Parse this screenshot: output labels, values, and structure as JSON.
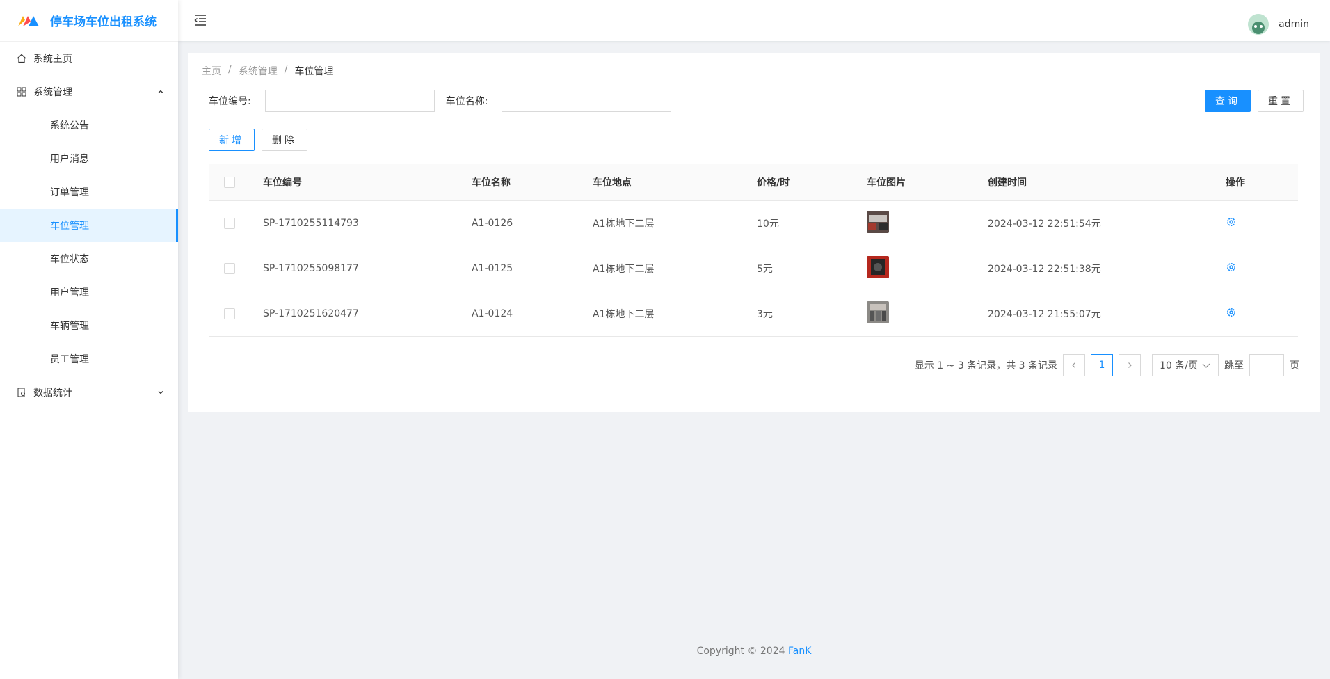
{
  "app": {
    "title": "停车场车位出租系统",
    "brand_colors": [
      "#ff4d4f",
      "#1890ff",
      "#faad14"
    ]
  },
  "sidebar": {
    "items": [
      {
        "label": "系统主页",
        "icon": "home-icon"
      },
      {
        "label": "系统管理",
        "icon": "grid-icon",
        "expanded": true,
        "children": [
          "系统公告",
          "用户消息",
          "订单管理",
          "车位管理",
          "车位状态",
          "用户管理",
          "车辆管理",
          "员工管理"
        ],
        "active_child": "车位管理"
      },
      {
        "label": "数据统计",
        "icon": "chart-file-icon",
        "expanded": false
      }
    ]
  },
  "header": {
    "username": "admin"
  },
  "breadcrumb": [
    "主页",
    "系统管理",
    "车位管理"
  ],
  "search": {
    "code_label": "车位编号:",
    "code_value": "",
    "name_label": "车位名称:",
    "name_value": "",
    "query_button": "查询",
    "reset_button": "重置"
  },
  "actions": {
    "add_button": "新增",
    "delete_button": "删除"
  },
  "table": {
    "columns": [
      "车位编号",
      "车位名称",
      "车位地点",
      "价格/时",
      "车位图片",
      "创建时间",
      "操作"
    ],
    "rows": [
      {
        "code": "SP-1710255114793",
        "name": "A1-0126",
        "location": "A1栋地下二层",
        "price": "10元",
        "time": "2024-03-12 22:51:54元"
      },
      {
        "code": "SP-1710255098177",
        "name": "A1-0125",
        "location": "A1栋地下二层",
        "price": "5元",
        "time": "2024-03-12 22:51:38元"
      },
      {
        "code": "SP-1710251620477",
        "name": "A1-0124",
        "location": "A1栋地下二层",
        "price": "3元",
        "time": "2024-03-12 21:55:07元"
      }
    ]
  },
  "pagination": {
    "info": "显示 1 ~ 3 条记录，共 3 条记录",
    "current_page": "1",
    "page_size": "10 条/页",
    "jump_label": "跳至",
    "page_suffix": "页"
  },
  "footer": {
    "copyright": "Copyright © 2024",
    "author": "FanK"
  },
  "colors": {
    "accent": "#1890ff",
    "active_bg": "#e6f4ff",
    "page_bg": "#f0f2f5"
  }
}
